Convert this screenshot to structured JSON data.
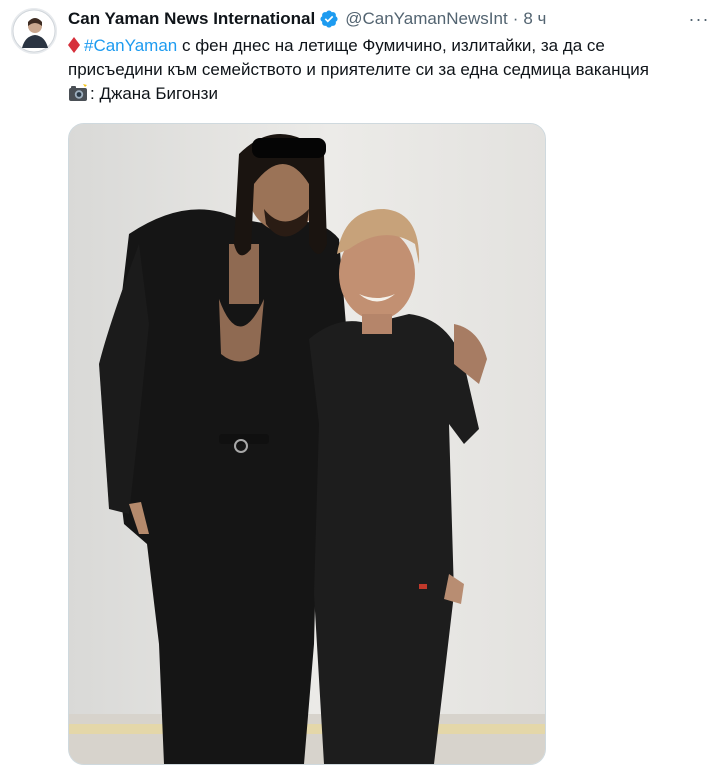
{
  "tweet": {
    "display_name": "Can Yaman News International",
    "handle": "@CanYamanNewsInt",
    "separator": "·",
    "time": "8 ч",
    "more_label": "···",
    "text_line1_hashtag": "#CanYaman",
    "text_line1_rest": " с фен днес на летище Фумичино, излитайки, за да се",
    "text_line2": "присъедини към семейството и приятелите си за една седмица ваканция",
    "text_line3": ": Джана Бигонзи"
  },
  "icons": {
    "verified": "verified-badge-icon",
    "diamond": "red-diamond-emoji",
    "camera": "camera-flash-emoji",
    "more": "more-options-icon"
  },
  "colors": {
    "link": "#1d9bf0",
    "verified": "#1d9bf0",
    "secondary_text": "#536471",
    "diamond": "#d6303b"
  }
}
